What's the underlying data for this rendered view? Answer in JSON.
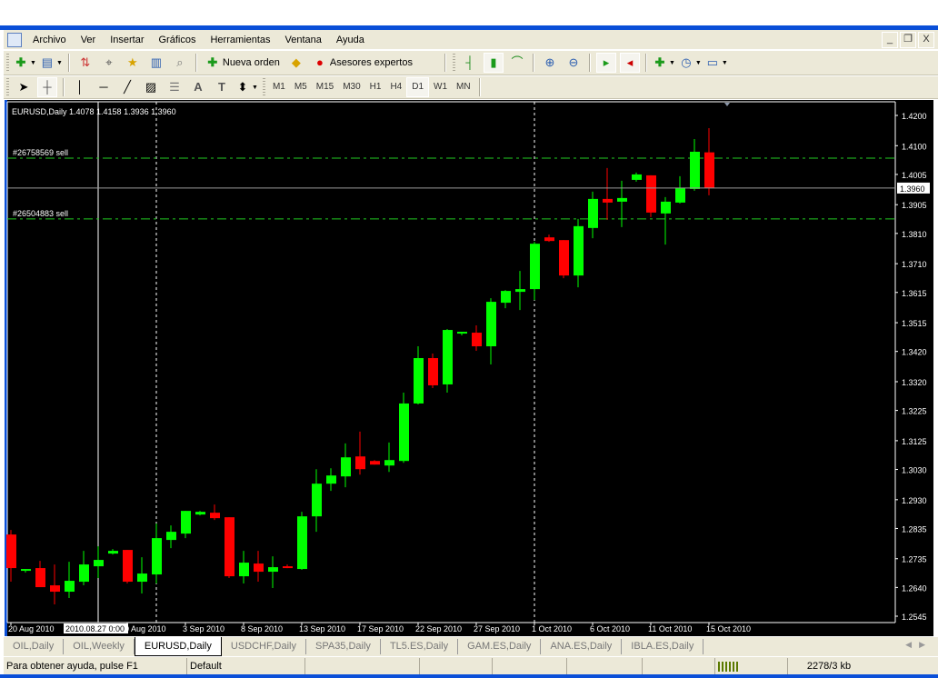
{
  "menu": {
    "items": [
      "Archivo",
      "Ver",
      "Insertar",
      "Gráficos",
      "Herramientas",
      "Ventana",
      "Ayuda"
    ]
  },
  "window_buttons": {
    "minimize": "_",
    "restore": "❐",
    "close": "X"
  },
  "toolbar1": {
    "new_order_label": "Nueva orden",
    "expert_advisors_label": "Asesores expertos"
  },
  "timeframes": [
    "M1",
    "M5",
    "M15",
    "M30",
    "H1",
    "H4",
    "D1",
    "W1",
    "MN"
  ],
  "active_timeframe": "D1",
  "chart": {
    "header": "EURUSD,Daily  1.4078 1.4158 1.3936 1.3960",
    "orders": [
      {
        "label": "#26758569 sell",
        "price": 1.4059
      },
      {
        "label": "#26504883 sell",
        "price": 1.3858
      }
    ],
    "current_price_label": "1.3960",
    "crosshair_time_label": "2010.08.27 0:00",
    "colors": {
      "bull": "#00ff00",
      "bear": "#ff0000",
      "order_line": "#22cc22",
      "background": "#000000",
      "grid_text": "#ffffff"
    }
  },
  "chart_data": {
    "type": "candlestick",
    "symbol": "EURUSD",
    "timeframe": "Daily",
    "ylim": [
      1.2545,
      1.42
    ],
    "y_ticks": [
      "1.4200",
      "1.4100",
      "1.4005",
      "1.3905",
      "1.3810",
      "1.3710",
      "1.3615",
      "1.3515",
      "1.3420",
      "1.3320",
      "1.3225",
      "1.3125",
      "1.3030",
      "1.2930",
      "1.2835",
      "1.2735",
      "1.2640",
      "1.2545"
    ],
    "x_labels": [
      {
        "bar": 0,
        "text": "20 Aug 2010"
      },
      {
        "bar": 8,
        "text": "0 Aug 2010"
      },
      {
        "bar": 12,
        "text": "3 Sep 2010"
      },
      {
        "bar": 16,
        "text": "8 Sep 2010"
      },
      {
        "bar": 20,
        "text": "13 Sep 2010"
      },
      {
        "bar": 24,
        "text": "17 Sep 2010"
      },
      {
        "bar": 28,
        "text": "22 Sep 2010"
      },
      {
        "bar": 32,
        "text": "27 Sep 2010"
      },
      {
        "bar": 36,
        "text": "1 Oct 2010"
      },
      {
        "bar": 40,
        "text": "6 Oct 2010"
      },
      {
        "bar": 44,
        "text": "11 Oct 2010"
      },
      {
        "bar": 48,
        "text": "15 Oct 2010"
      }
    ],
    "period_separators_at_bar": [
      10,
      36
    ],
    "crosshair_bar": 6,
    "ohlc": [
      [
        1.2815,
        1.283,
        1.2659,
        1.2704
      ],
      [
        1.2698,
        1.2701,
        1.2689,
        1.2701
      ],
      [
        1.2704,
        1.2728,
        1.2641,
        1.2641
      ],
      [
        1.2647,
        1.2716,
        1.2584,
        1.2626
      ],
      [
        1.2626,
        1.2725,
        1.2605,
        1.2662
      ],
      [
        1.2659,
        1.2761,
        1.2647,
        1.2716
      ],
      [
        1.271,
        1.2776,
        1.2671,
        1.2731
      ],
      [
        1.2752,
        1.2767,
        1.2749,
        1.2761
      ],
      [
        1.2764,
        1.2764,
        1.2653,
        1.2659
      ],
      [
        1.2659,
        1.274,
        1.262,
        1.2686
      ],
      [
        1.2683,
        1.2851,
        1.2653,
        1.2803
      ],
      [
        1.2797,
        1.2845,
        1.277,
        1.2824
      ],
      [
        1.2818,
        1.2893,
        1.2803,
        1.2893
      ],
      [
        1.2881,
        1.2893,
        1.2878,
        1.289
      ],
      [
        1.2887,
        1.2914,
        1.2863,
        1.2869
      ],
      [
        1.2872,
        1.2872,
        1.2671,
        1.2677
      ],
      [
        1.2677,
        1.2761,
        1.2653,
        1.2722
      ],
      [
        1.2719,
        1.2761,
        1.2659,
        1.2692
      ],
      [
        1.2692,
        1.2743,
        1.2638,
        1.2707
      ],
      [
        1.271,
        1.2716,
        1.2704,
        1.2704
      ],
      [
        1.2701,
        1.289,
        1.2698,
        1.2875
      ],
      [
        1.2875,
        1.3031,
        1.2824,
        1.2983
      ],
      [
        1.2983,
        1.3034,
        1.2959,
        1.301
      ],
      [
        1.3007,
        1.3116,
        1.2971,
        1.307
      ],
      [
        1.3073,
        1.3155,
        1.3013,
        1.3031
      ],
      [
        1.3058,
        1.3061,
        1.3046,
        1.3046
      ],
      [
        1.3043,
        1.3119,
        1.3022,
        1.3061
      ],
      [
        1.3058,
        1.3284,
        1.3052,
        1.3248
      ],
      [
        1.3248,
        1.3437,
        1.3245,
        1.3398
      ],
      [
        1.3398,
        1.3413,
        1.3299,
        1.3308
      ],
      [
        1.3311,
        1.3494,
        1.3284,
        1.3491
      ],
      [
        1.3482,
        1.3485,
        1.3473,
        1.3485
      ],
      [
        1.3482,
        1.3506,
        1.3422,
        1.3437
      ],
      [
        1.3437,
        1.3596,
        1.3377,
        1.3584
      ],
      [
        1.3581,
        1.3623,
        1.3563,
        1.362
      ],
      [
        1.3617,
        1.3686,
        1.3557,
        1.3626
      ],
      [
        1.3626,
        1.3782,
        1.359,
        1.3776
      ],
      [
        1.3797,
        1.3806,
        1.3782,
        1.3785
      ],
      [
        1.3788,
        1.3788,
        1.3662,
        1.3671
      ],
      [
        1.3671,
        1.3858,
        1.3632,
        1.3834
      ],
      [
        1.3828,
        1.3948,
        1.3794,
        1.3924
      ],
      [
        1.3924,
        1.4026,
        1.3855,
        1.3912
      ],
      [
        1.3915,
        1.3984,
        1.3831,
        1.3927
      ],
      [
        1.3987,
        1.4011,
        1.3981,
        1.4005
      ],
      [
        1.4002,
        1.4002,
        1.3864,
        1.3879
      ],
      [
        1.3876,
        1.393,
        1.3773,
        1.3915
      ],
      [
        1.3912,
        1.3999,
        1.3909,
        1.396
      ],
      [
        1.3957,
        1.4122,
        1.3951,
        1.408
      ],
      [
        1.4078,
        1.4158,
        1.3936,
        1.396
      ]
    ]
  },
  "tabs": {
    "items": [
      "OIL,Daily",
      "OIL,Weekly",
      "EURUSD,Daily",
      "USDCHF,Daily",
      "SPA35,Daily",
      "TL5.ES,Daily",
      "GAM.ES,Daily",
      "ANA.ES,Daily",
      "IBLA.ES,Daily"
    ],
    "active": "EURUSD,Daily"
  },
  "status": {
    "help": "Para obtener ayuda, pulse F1",
    "profile": "Default",
    "traffic": "2278/3 kb"
  }
}
